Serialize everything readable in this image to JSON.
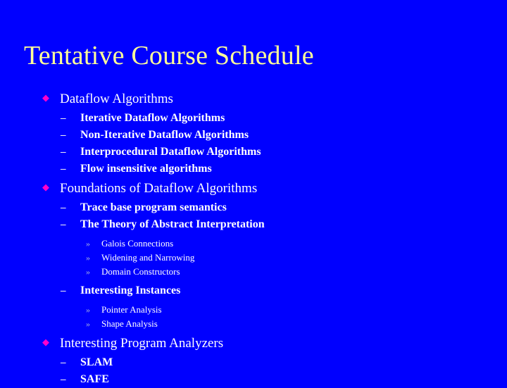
{
  "slide": {
    "title": "Tentative Course Schedule",
    "background_color": "#0000FF",
    "title_color": "#FFFF99",
    "text_color": "#FFFFFF",
    "bullet_l1_color": "#FF00CC",
    "bullet_l3_color": "#A8B4DE",
    "markers": {
      "level1": "◆",
      "level2": "–",
      "level3": "»"
    },
    "outline": [
      {
        "level": 1,
        "text": "Dataflow Algorithms"
      },
      {
        "level": 2,
        "text": "Iterative Dataflow Algorithms"
      },
      {
        "level": 2,
        "text": "Non-Iterative Dataflow Algorithms"
      },
      {
        "level": 2,
        "text": "Interprocedural Dataflow Algorithms"
      },
      {
        "level": 2,
        "text": "Flow insensitive algorithms"
      },
      {
        "level": 1,
        "text": "Foundations of Dataflow Algorithms"
      },
      {
        "level": 2,
        "text": "Trace base program semantics"
      },
      {
        "level": 2,
        "text": "The Theory of Abstract Interpretation"
      },
      {
        "level": 3,
        "text": "Galois Connections"
      },
      {
        "level": 3,
        "text": "Widening and Narrowing"
      },
      {
        "level": 3,
        "text": "Domain Constructors"
      },
      {
        "level": 2,
        "text": "Interesting Instances"
      },
      {
        "level": 3,
        "text": "Pointer Analysis"
      },
      {
        "level": 3,
        "text": "Shape Analysis"
      },
      {
        "level": 1,
        "text": "Interesting Program Analyzers"
      },
      {
        "level": 2,
        "text": "SLAM"
      },
      {
        "level": 2,
        "text": "SAFE"
      }
    ]
  }
}
